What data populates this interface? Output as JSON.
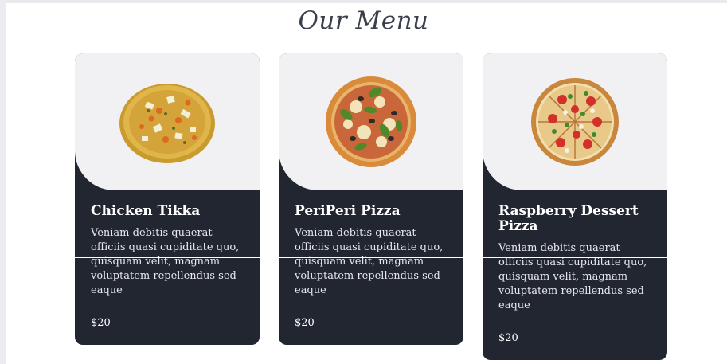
{
  "menu": {
    "title": "Our Menu",
    "items": [
      {
        "name": "Chicken Tikka",
        "description": "Veniam debitis quaerat officiis quasi cupiditate quo, quisquam velit, magnam voluptatem repellendus sed eaque",
        "price": "$20",
        "image_icon": "chicken-tikka-pizza-image"
      },
      {
        "name": "PeriPeri Pizza",
        "description": "Veniam debitis quaerat officiis quasi cupiditate quo, quisquam velit, magnam voluptatem repellendus sed eaque",
        "price": "$20",
        "image_icon": "periperi-pizza-image"
      },
      {
        "name": "Raspberry Dessert Pizza",
        "description": "Veniam debitis quaerat officiis quasi cupiditate quo, quisquam velit, magnam voluptatem repellendus sed eaque",
        "price": "$20",
        "image_icon": "raspberry-dessert-pizza-image"
      }
    ]
  },
  "colors": {
    "card_background": "#212631",
    "image_background": "#f1f1f3",
    "title": "#3a3f4a"
  }
}
